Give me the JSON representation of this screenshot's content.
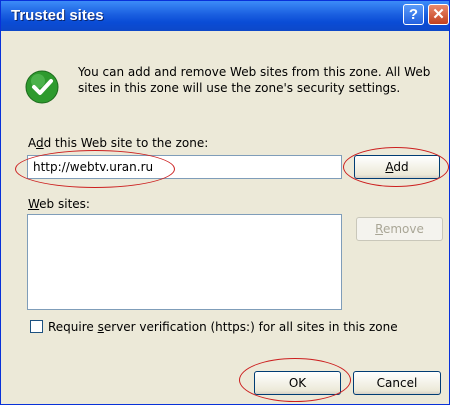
{
  "window": {
    "title": "Trusted sites",
    "help_glyph": "?",
    "close_glyph": "✕"
  },
  "info": {
    "message": "You can add and remove Web sites from this zone. All Web sites in this zone will use the zone's security settings.",
    "icon": "check-icon"
  },
  "add_site": {
    "label_prefix": "A",
    "label_accel": "d",
    "label_rest": "d this Web site to the zone:",
    "value": "http://webtv.uran.ru",
    "add_accel": "A",
    "add_rest": "dd"
  },
  "web_sites": {
    "label_accel": "W",
    "label_rest": "eb sites:",
    "items": [],
    "remove_accel": "R",
    "remove_rest": "emove"
  },
  "verification": {
    "checked": false,
    "label_prefix": "Require ",
    "label_accel": "s",
    "label_rest": "erver verification (https:) for all sites in this zone"
  },
  "footer": {
    "ok_label": "OK",
    "cancel_label": "Cancel"
  },
  "colors": {
    "titlebar": "#0a4cd6",
    "annotation": "#cc1f1f",
    "dialog_bg": "#ece9d8"
  }
}
